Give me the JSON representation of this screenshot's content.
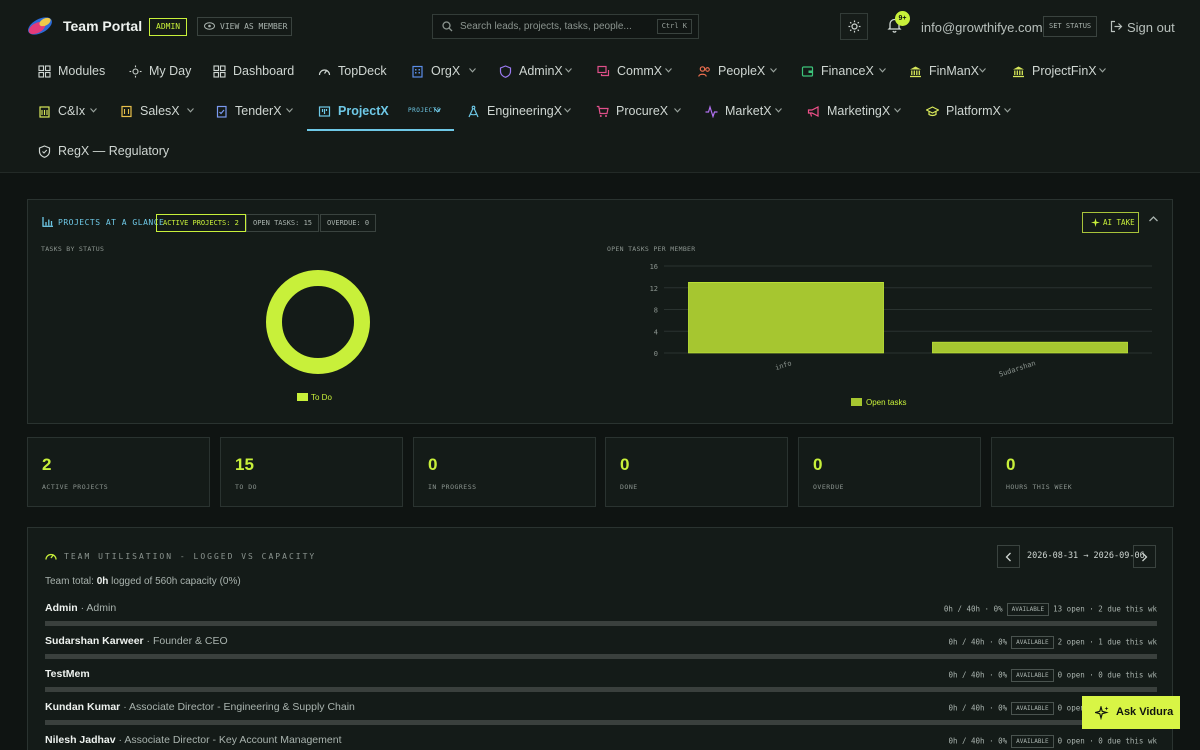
{
  "header": {
    "brand": "Team Portal",
    "role_badge": "ADMIN",
    "view_as_member": "VIEW AS MEMBER",
    "search_placeholder": "Search leads, projects, tasks, people...",
    "search_shortcut": "Ctrl K",
    "notification_count": "9+",
    "user_email": "info@growthifye.com",
    "set_status": "SET STATUS",
    "sign_out": "Sign out"
  },
  "nav": [
    {
      "label": "Modules",
      "icon": "grid-icon"
    },
    {
      "label": "My Day",
      "icon": "sun-icon"
    },
    {
      "label": "Dashboard",
      "icon": "grid-icon"
    },
    {
      "label": "TopDeck",
      "icon": "gauge-icon"
    },
    {
      "label": "OrgX",
      "icon": "building-icon"
    },
    {
      "label": "AdminX",
      "icon": "shield-icon"
    },
    {
      "label": "CommX",
      "icon": "chat-icon"
    },
    {
      "label": "PeopleX",
      "icon": "people-icon"
    },
    {
      "label": "FinanceX",
      "icon": "wallet-icon"
    },
    {
      "label": "FinManX",
      "icon": "bank-icon"
    },
    {
      "label": "ProjectFinX",
      "icon": "bank-icon"
    },
    {
      "label": "C&Ix",
      "icon": "clipboard-icon"
    },
    {
      "label": "SalesX",
      "icon": "document-icon"
    },
    {
      "label": "TenderX",
      "icon": "tender-icon"
    },
    {
      "label": "ProjectX",
      "icon": "kanban-icon",
      "tag": "PROJECTS"
    },
    {
      "label": "EngineeringX",
      "icon": "compass-icon"
    },
    {
      "label": "ProcureX",
      "icon": "cart-icon"
    },
    {
      "label": "MarketX",
      "icon": "pulse-icon"
    },
    {
      "label": "MarketingX",
      "icon": "megaphone-icon"
    },
    {
      "label": "PlatformX",
      "icon": "cap-icon"
    },
    {
      "label": "RegX — Regulatory",
      "icon": "shield-check-icon"
    }
  ],
  "glance": {
    "title": "PROJECTS AT A GLANCE",
    "chips": [
      "ACTIVE PROJECTS: 2",
      "OPEN TASKS: 15",
      "OVERDUE: 0"
    ],
    "ai_take": "AI TAKE"
  },
  "chart_data": [
    {
      "type": "pie",
      "title": "TASKS BY STATUS",
      "categories": [
        "To Do"
      ],
      "values": [
        15
      ],
      "colors": [
        "#c8f03a"
      ],
      "legend": "bottom"
    },
    {
      "type": "bar",
      "title": "OPEN TASKS PER MEMBER",
      "categories": [
        "info",
        "Sudarshan"
      ],
      "series": [
        {
          "name": "Open tasks",
          "values": [
            13,
            2
          ]
        }
      ],
      "ylim": [
        0,
        16
      ],
      "yticks": [
        "16",
        "12",
        "8",
        "4",
        "0"
      ],
      "legend": "bottom",
      "grid": true,
      "color": "#a6c630"
    }
  ],
  "stats": [
    {
      "value": "2",
      "label": "ACTIVE PROJECTS"
    },
    {
      "value": "15",
      "label": "TO DO"
    },
    {
      "value": "0",
      "label": "IN PROGRESS"
    },
    {
      "value": "0",
      "label": "DONE"
    },
    {
      "value": "0",
      "label": "OVERDUE"
    },
    {
      "value": "0",
      "label": "HOURS THIS WEEK"
    }
  ],
  "utilisation": {
    "title": "TEAM UTILISATION - LOGGED VS CAPACITY",
    "range": "2026-08-31 → 2026-09-06",
    "total_prefix": "Team total:",
    "total_logged": "0h",
    "total_suffix": "logged of 560h capacity (0%)",
    "rows": [
      {
        "name": "Admin",
        "role": "· Admin",
        "hours": "0h / 40h · 0%",
        "status": "AVAILABLE",
        "tasks": "13 open · 2 due this wk",
        "utilisation": 0
      },
      {
        "name": "Sudarshan Karweer",
        "role": "· Founder & CEO",
        "hours": "0h / 40h · 0%",
        "status": "AVAILABLE",
        "tasks": "2 open · 1 due this wk",
        "utilisation": 0
      },
      {
        "name": "TestMem",
        "role": "",
        "hours": "0h / 40h · 0%",
        "status": "AVAILABLE",
        "tasks": "0 open · 0 due this wk",
        "utilisation": 0
      },
      {
        "name": "Kundan Kumar",
        "role": "· Associate Director - Engineering & Supply Chain",
        "hours": "0h / 40h · 0%",
        "status": "AVAILABLE",
        "tasks": "0 open · 0 due this wk",
        "utilisation": 0
      },
      {
        "name": "Nilesh Jadhav",
        "role": "· Associate Director - Key Account Management",
        "hours": "0h / 40h · 0%",
        "status": "AVAILABLE",
        "tasks": "0 open · 0 due this wk",
        "utilisation": 0
      }
    ]
  },
  "ask_button": "Ask Vidura",
  "colors": {
    "accent": "#c8f03a",
    "link": "#6ec8e6",
    "background": "#0f1412"
  }
}
